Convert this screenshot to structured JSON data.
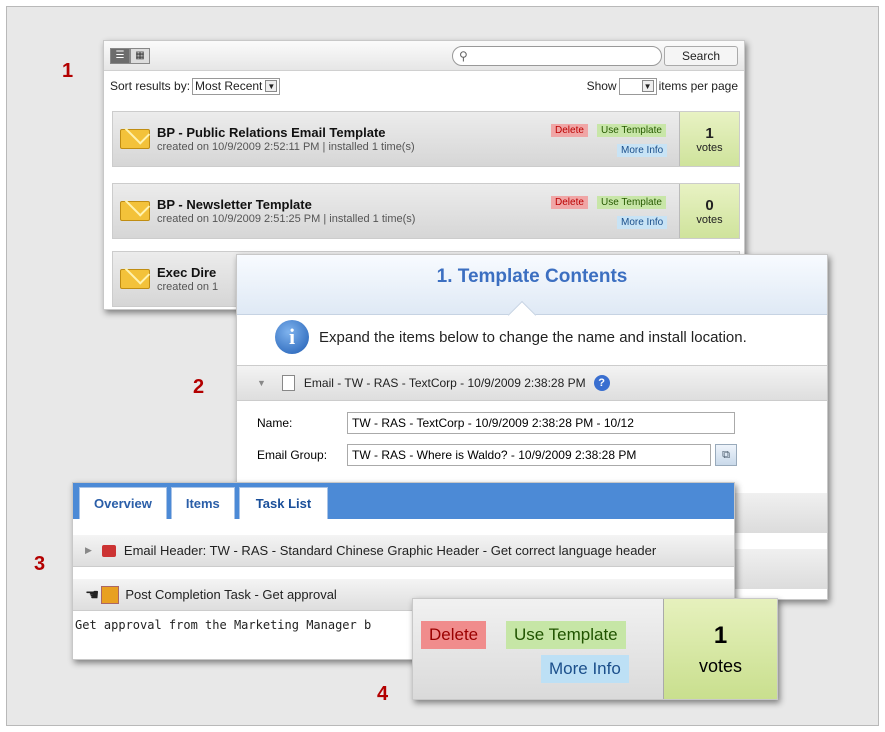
{
  "steps": {
    "s1": "1",
    "s2": "2",
    "s3": "3",
    "s4": "4"
  },
  "panel1": {
    "search_button": "Search",
    "sort_label": "Sort results by:",
    "sort_value": "Most Recent",
    "show_label": "Show",
    "show_value": "",
    "per_page_label": "items per page",
    "templates": [
      {
        "title": "BP - Public Relations Email Template",
        "meta": "created on 10/9/2009 2:52:11 PM | installed 1 time(s)",
        "delete": "Delete",
        "use": "Use Template",
        "more": "More Info",
        "votes": "1",
        "votes_label": "votes"
      },
      {
        "title": "BP - Newsletter Template",
        "meta": "created on 10/9/2009 2:51:25 PM | installed 1 time(s)",
        "delete": "Delete",
        "use": "Use Template",
        "more": "More Info",
        "votes": "0",
        "votes_label": "votes"
      },
      {
        "title": "Exec Dire",
        "meta": "created on 1"
      }
    ]
  },
  "panel2": {
    "title": "1. Template Contents",
    "info_text": "Expand the items below to change the name and install location.",
    "email_item": "Email - TW - RAS - TextCorp - 10/9/2009 2:38:28 PM",
    "name_label": "Name:",
    "name_value": "TW - RAS - TextCorp - 10/9/2009 2:38:28 PM - 10/12",
    "group_label": "Email Group:",
    "group_value": "TW - RAS - Where is Waldo? - 10/9/2009 2:38:28 PM"
  },
  "panel3": {
    "tabs": [
      "Overview",
      "Items",
      "Task List"
    ],
    "header_item": "Email Header: TW - RAS - Standard Chinese Graphic Header - Get correct language header",
    "task_item": "Post Completion Task - Get approval",
    "note": "Get approval from the Marketing Manager b"
  },
  "panel4": {
    "delete": "Delete",
    "use": "Use Template",
    "more": "More Info",
    "votes": "1",
    "votes_label": "votes"
  }
}
